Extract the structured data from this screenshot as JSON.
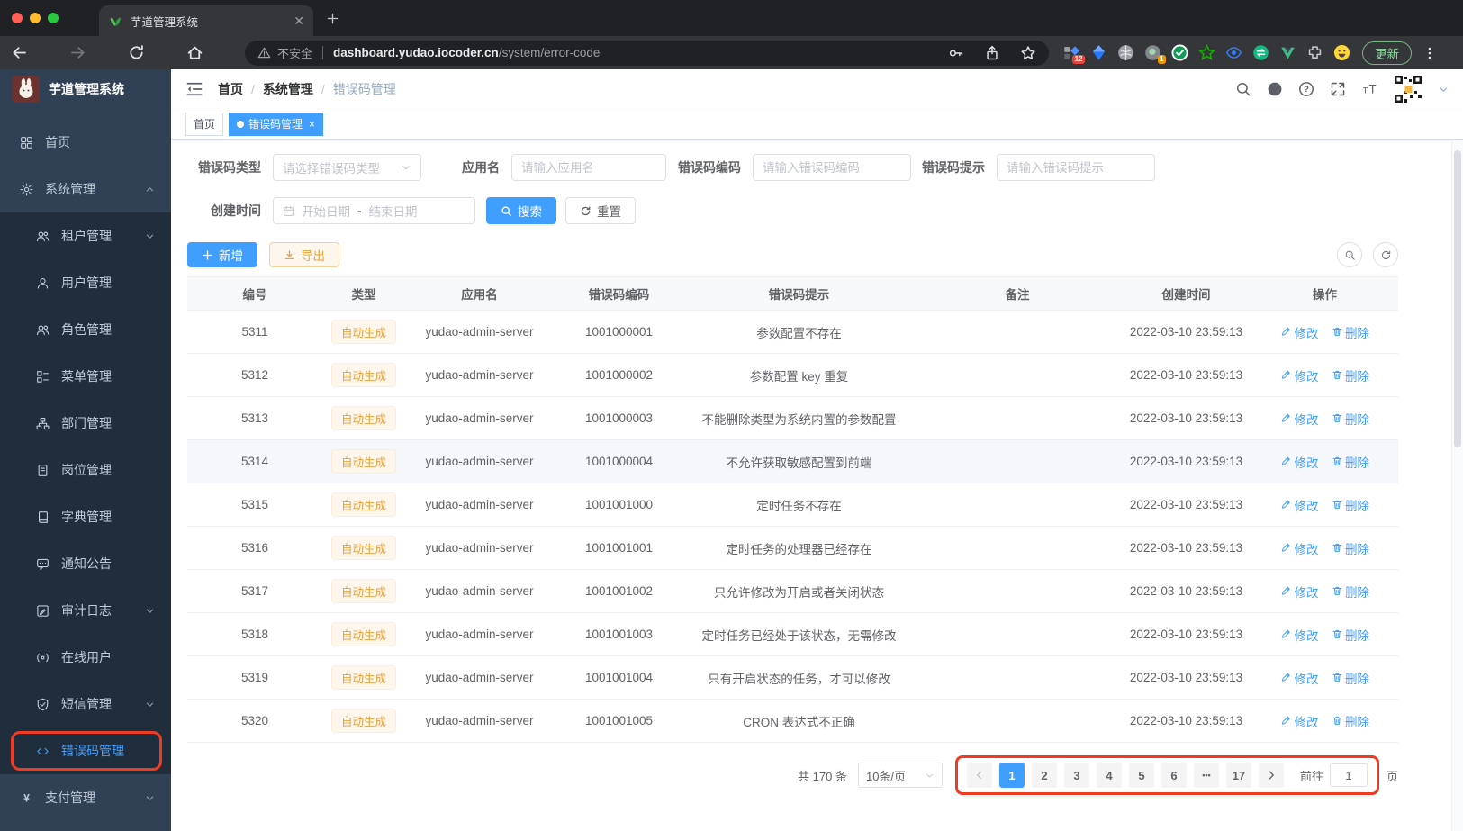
{
  "browser": {
    "tab_title": "芋道管理系统",
    "security_label": "不安全",
    "url_domain": "dashboard.yudao.iocoder.cn",
    "url_path": "/system/error-code",
    "ext_badge_blue": "12",
    "ext_badge_gray": "1",
    "update_label": "更新"
  },
  "sidebar": {
    "logo_title": "芋道管理系统",
    "items": [
      {
        "label": "首页",
        "icon": "dashboard-icon",
        "level": 1
      },
      {
        "label": "系统管理",
        "icon": "gear-icon",
        "level": 1,
        "caret": "up"
      },
      {
        "label": "租户管理",
        "icon": "tenant-users-icon",
        "level": 2,
        "caret": "down"
      },
      {
        "label": "用户管理",
        "icon": "user-icon",
        "level": 2
      },
      {
        "label": "角色管理",
        "icon": "role-icon",
        "level": 2
      },
      {
        "label": "菜单管理",
        "icon": "menu-tree-icon",
        "level": 2
      },
      {
        "label": "部门管理",
        "icon": "org-tree-icon",
        "level": 2
      },
      {
        "label": "岗位管理",
        "icon": "post-icon",
        "level": 2
      },
      {
        "label": "字典管理",
        "icon": "dict-book-icon",
        "level": 2
      },
      {
        "label": "通知公告",
        "icon": "notice-icon",
        "level": 2
      },
      {
        "label": "审计日志",
        "icon": "audit-log-icon",
        "level": 2,
        "caret": "down"
      },
      {
        "label": "在线用户",
        "icon": "online-user-icon",
        "level": 2
      },
      {
        "label": "短信管理",
        "icon": "sms-shield-icon",
        "level": 2,
        "caret": "down"
      },
      {
        "label": "错误码管理",
        "icon": "code-icon",
        "level": 2,
        "active": true,
        "annotated": true
      },
      {
        "label": "支付管理",
        "icon": "pay-yen-icon",
        "level": 1,
        "caret": "down"
      }
    ]
  },
  "header": {
    "breadcrumb": [
      "首页",
      "系统管理",
      "错误码管理"
    ]
  },
  "tags": [
    {
      "label": "首页",
      "active": false
    },
    {
      "label": "错误码管理",
      "active": true,
      "closable": true
    }
  ],
  "filters": {
    "type_label": "错误码类型",
    "type_placeholder": "请选择错误码类型",
    "app_label": "应用名",
    "app_placeholder": "请输入应用名",
    "code_label": "错误码编码",
    "code_placeholder": "请输入错误码编码",
    "msg_label": "错误码提示",
    "msg_placeholder": "请输入错误码提示",
    "date_label": "创建时间",
    "date_start": "开始日期",
    "date_separator": "-",
    "date_end": "结束日期",
    "search_label": "搜索",
    "reset_label": "重置"
  },
  "toolbar": {
    "add_label": "新增",
    "export_label": "导出"
  },
  "table": {
    "columns": [
      "编号",
      "类型",
      "应用名",
      "错误码编码",
      "错误码提示",
      "备注",
      "创建时间",
      "操作"
    ],
    "type_tag": "自动生成",
    "edit_label": "修改",
    "delete_label": "删除",
    "rows": [
      {
        "id": "5311",
        "app": "yudao-admin-server",
        "code": "1001000001",
        "msg": "参数配置不存在",
        "remark": "",
        "created": "2022-03-10 23:59:13"
      },
      {
        "id": "5312",
        "app": "yudao-admin-server",
        "code": "1001000002",
        "msg": "参数配置 key 重复",
        "remark": "",
        "created": "2022-03-10 23:59:13"
      },
      {
        "id": "5313",
        "app": "yudao-admin-server",
        "code": "1001000003",
        "msg": "不能删除类型为系统内置的参数配置",
        "remark": "",
        "created": "2022-03-10 23:59:13"
      },
      {
        "id": "5314",
        "app": "yudao-admin-server",
        "code": "1001000004",
        "msg": "不允许获取敏感配置到前端",
        "remark": "",
        "created": "2022-03-10 23:59:13",
        "highlighted": true
      },
      {
        "id": "5315",
        "app": "yudao-admin-server",
        "code": "1001001000",
        "msg": "定时任务不存在",
        "remark": "",
        "created": "2022-03-10 23:59:13"
      },
      {
        "id": "5316",
        "app": "yudao-admin-server",
        "code": "1001001001",
        "msg": "定时任务的处理器已经存在",
        "remark": "",
        "created": "2022-03-10 23:59:13"
      },
      {
        "id": "5317",
        "app": "yudao-admin-server",
        "code": "1001001002",
        "msg": "只允许修改为开启或者关闭状态",
        "remark": "",
        "created": "2022-03-10 23:59:13"
      },
      {
        "id": "5318",
        "app": "yudao-admin-server",
        "code": "1001001003",
        "msg": "定时任务已经处于该状态，无需修改",
        "remark": "",
        "created": "2022-03-10 23:59:13"
      },
      {
        "id": "5319",
        "app": "yudao-admin-server",
        "code": "1001001004",
        "msg": "只有开启状态的任务，才可以修改",
        "remark": "",
        "created": "2022-03-10 23:59:13"
      },
      {
        "id": "5320",
        "app": "yudao-admin-server",
        "code": "1001001005",
        "msg": "CRON 表达式不正确",
        "remark": "",
        "created": "2022-03-10 23:59:13"
      }
    ]
  },
  "pagination": {
    "total_text": "共 170 条",
    "page_size": "10条/页",
    "pages": [
      "1",
      "2",
      "3",
      "4",
      "5",
      "6",
      "•••",
      "17"
    ],
    "active_page": "1",
    "goto_label": "前往",
    "goto_value": "1",
    "page_unit": "页"
  },
  "colors": {
    "primary": "#409eff",
    "warning": "#e6a23c",
    "annotation": "#ef3b24",
    "sidebar": "#304156"
  }
}
